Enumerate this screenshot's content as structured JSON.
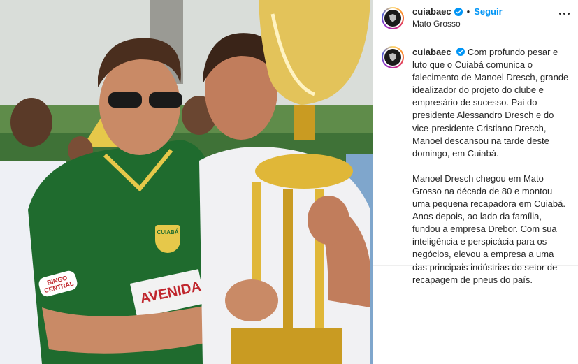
{
  "post": {
    "username": "cuiabaec",
    "follow_label": "Seguir",
    "separator": "•",
    "location": "Mato Grosso",
    "caption_p1_lead": "Com profundo pesar e luto que o Cuiabá comunica o falecimento de Manoel Dresch, grande idealizador do projeto do clube e empresário de sucesso. Pai do presidente Alessandro Dresch e do vice-presidente Cristiano Dresch, Manoel descansou na tarde deste domingo, em Cuiabá.",
    "caption_p2": "Manoel Dresch chegou em Mato Grosso na década de 80 e montou uma pequena recapadora em Cuiabá. Anos depois, ao lado da família, fundou a empresa Drebor. Com sua inteligência e perspicácia para os negócios, elevou a empresa a uma das principais indústrias do setor de recapagem de pneus do país."
  },
  "photo": {
    "jersey_text": "AVENIDA",
    "sponsor_text": "BINGO CENTRAL",
    "badge_text": "CUIABÁ"
  },
  "colors": {
    "accent_blue": "#0095f6",
    "jersey_green": "#1f6b2e",
    "trophy_gold": "#d4a82a"
  }
}
